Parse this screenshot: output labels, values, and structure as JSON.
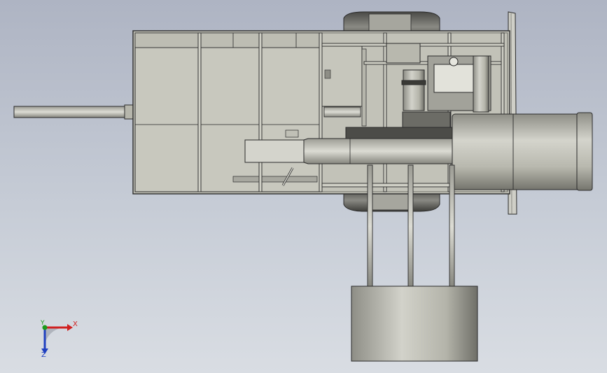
{
  "viewport": {
    "background_top": "#aeb4c3",
    "background_bottom": "#d9dde3",
    "model_fill": "#c3c3b9",
    "model_edge": "#2a2a2a"
  },
  "triad": {
    "x_label": "X",
    "y_label": "Y",
    "z_label": "Z",
    "x_color": "#d02020",
    "y_color": "#1a9a1a",
    "z_color": "#2040c0"
  }
}
